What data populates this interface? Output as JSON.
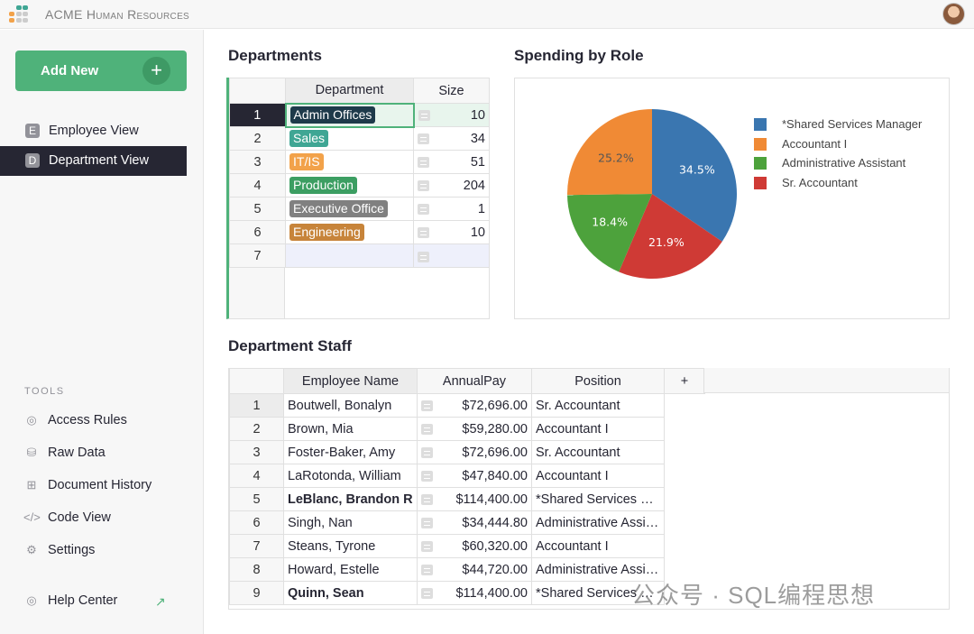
{
  "app": {
    "title": "ACME Human Resources"
  },
  "sidebar": {
    "add_new": "Add New",
    "pages": [
      {
        "badge": "E",
        "label": "Employee View",
        "active": false
      },
      {
        "badge": "D",
        "label": "Department View",
        "active": true
      }
    ],
    "tools_heading": "TOOLS",
    "tools": [
      {
        "icon": "eye-icon",
        "label": "Access Rules"
      },
      {
        "icon": "database-icon",
        "label": "Raw Data"
      },
      {
        "icon": "history-icon",
        "label": "Document History"
      },
      {
        "icon": "code-icon",
        "label": "Code View"
      },
      {
        "icon": "gear-icon",
        "label": "Settings"
      }
    ],
    "help": "Help Center"
  },
  "departments": {
    "title": "Departments",
    "columns": [
      "Department",
      "Size"
    ],
    "rows": [
      {
        "n": "1",
        "dept": "Admin Offices",
        "size": "10",
        "color": "#1e3a4a"
      },
      {
        "n": "2",
        "dept": "Sales",
        "size": "34",
        "color": "#3fa694"
      },
      {
        "n": "3",
        "dept": "IT/IS",
        "size": "51",
        "color": "#f2a24a"
      },
      {
        "n": "4",
        "dept": "Production",
        "size": "204",
        "color": "#3c9e62"
      },
      {
        "n": "5",
        "dept": "Executive Office",
        "size": "1",
        "color": "#808080"
      },
      {
        "n": "6",
        "dept": "Engineering",
        "size": "10",
        "color": "#c7843a"
      },
      {
        "n": "7",
        "dept": "",
        "size": "",
        "color": ""
      }
    ]
  },
  "chart_data": {
    "type": "pie",
    "title": "Spending by Role",
    "legend": "right",
    "series": [
      {
        "name": "*Shared Services Manager",
        "value": 34.5,
        "label": "34.5%",
        "color": "#3a76b0"
      },
      {
        "name": "Sr. Accountant",
        "value": 21.9,
        "label": "21.9%",
        "color": "#cf3a35"
      },
      {
        "name": "Administrative Assistant",
        "value": 18.4,
        "label": "18.4%",
        "color": "#4da23c"
      },
      {
        "name": "Accountant I",
        "value": 25.2,
        "label": "25.2%",
        "color": "#f08a35"
      }
    ],
    "legend_order": [
      "*Shared Services Manager",
      "Accountant I",
      "Administrative Assistant",
      "Sr. Accountant"
    ]
  },
  "staff": {
    "title": "Department Staff",
    "columns": [
      "Employee Name",
      "AnnualPay",
      "Position",
      "+"
    ],
    "rows": [
      {
        "n": "1",
        "name": "Boutwell, Bonalyn",
        "pay": "$72,696.00",
        "pos": "Sr. Accountant",
        "bold": false
      },
      {
        "n": "2",
        "name": "Brown, Mia",
        "pay": "$59,280.00",
        "pos": "Accountant I",
        "bold": false
      },
      {
        "n": "3",
        "name": "Foster-Baker, Amy",
        "pay": "$72,696.00",
        "pos": "Sr. Accountant",
        "bold": false
      },
      {
        "n": "4",
        "name": "LaRotonda, William",
        "pay": "$47,840.00",
        "pos": "Accountant I",
        "bold": false
      },
      {
        "n": "5",
        "name": "LeBlanc, Brandon R",
        "pay": "$114,400.00",
        "pos": "*Shared Services Manager",
        "bold": true
      },
      {
        "n": "6",
        "name": "Singh, Nan",
        "pay": "$34,444.80",
        "pos": "Administrative Assistant",
        "bold": false
      },
      {
        "n": "7",
        "name": "Steans, Tyrone",
        "pay": "$60,320.00",
        "pos": "Accountant I",
        "bold": false
      },
      {
        "n": "8",
        "name": "Howard, Estelle",
        "pay": "$44,720.00",
        "pos": "Administrative Assistant",
        "bold": false
      },
      {
        "n": "9",
        "name": "Quinn, Sean",
        "pay": "$114,400.00",
        "pos": "*Shared Services Manager",
        "bold": true
      }
    ]
  },
  "watermark": "公众号 · SQL编程思想"
}
